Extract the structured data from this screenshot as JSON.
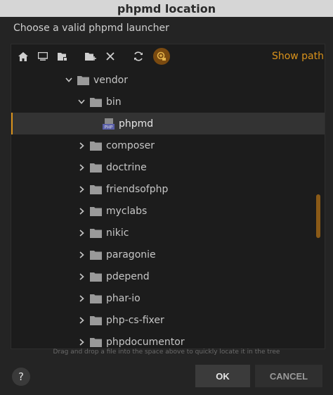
{
  "window": {
    "title": "phpmd location"
  },
  "prompt": "Choose a valid phpmd launcher",
  "toolbar": {
    "show_path_label": "Show path"
  },
  "tree": {
    "items": [
      {
        "label": "vendor",
        "expanded": true,
        "type": "folder"
      },
      {
        "label": "bin",
        "expanded": true,
        "type": "folder"
      },
      {
        "label": "phpmd",
        "type": "php-file",
        "selected": true
      },
      {
        "label": "composer",
        "expanded": false,
        "type": "folder"
      },
      {
        "label": "doctrine",
        "expanded": false,
        "type": "folder"
      },
      {
        "label": "friendsofphp",
        "expanded": false,
        "type": "folder"
      },
      {
        "label": "myclabs",
        "expanded": false,
        "type": "folder"
      },
      {
        "label": "nikic",
        "expanded": false,
        "type": "folder"
      },
      {
        "label": "paragonie",
        "expanded": false,
        "type": "folder"
      },
      {
        "label": "pdepend",
        "expanded": false,
        "type": "folder"
      },
      {
        "label": "phar-io",
        "expanded": false,
        "type": "folder"
      },
      {
        "label": "php-cs-fixer",
        "expanded": false,
        "type": "folder"
      },
      {
        "label": "phpdocumentor",
        "expanded": false,
        "type": "folder"
      }
    ]
  },
  "hint": "Drag and drop a file into the space above to quickly locate it in the tree",
  "buttons": {
    "help_label": "?",
    "ok_label": "OK",
    "cancel_label": "CANCEL"
  },
  "colors": {
    "accent": "#d9921b",
    "background": "#242424",
    "panel": "#1c1c1c"
  }
}
